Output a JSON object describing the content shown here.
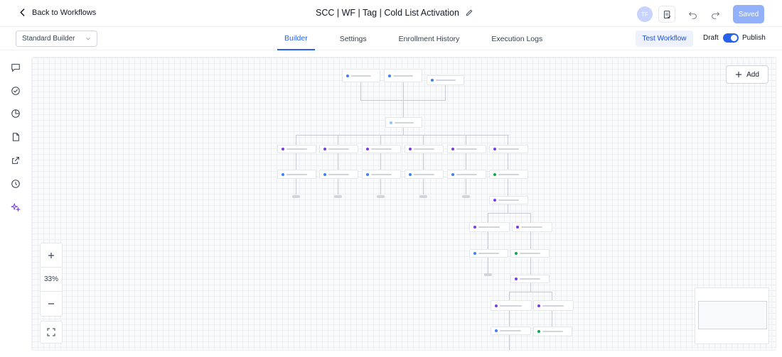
{
  "header": {
    "back_label": "Back to Workflows",
    "title": "SCC | WF | Tag | Cold List Activation",
    "avatar_initials": "TF",
    "saved_label": "Saved"
  },
  "subbar": {
    "builder_select": "Standard Builder",
    "tabs": [
      {
        "label": "Builder",
        "active": true
      },
      {
        "label": "Settings"
      },
      {
        "label": "Enrollment History"
      },
      {
        "label": "Execution Logs"
      }
    ],
    "test_label": "Test Workflow",
    "draft_label": "Draft",
    "publish_label": "Publish"
  },
  "canvas": {
    "add_label": "Add",
    "zoom_level": "33%"
  },
  "colors": {
    "accent": "#2563eb",
    "saved_bg": "#93b0fb",
    "purple": "#7c3aed",
    "green": "#16a34a"
  }
}
